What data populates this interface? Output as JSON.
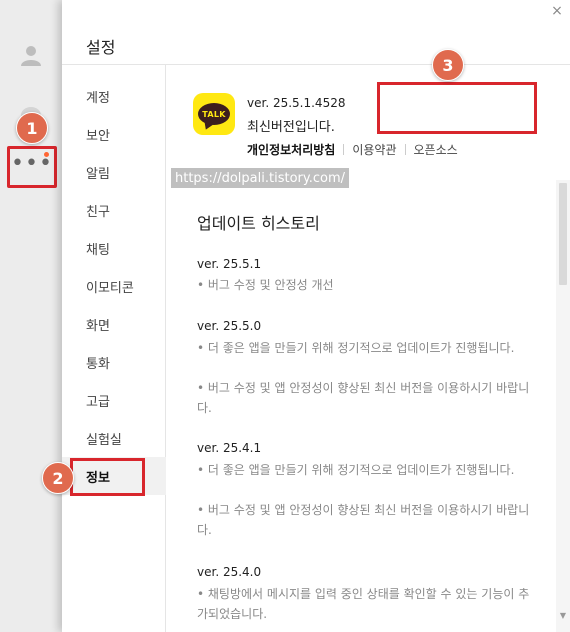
{
  "rail": {
    "icons": [
      "person-icon",
      "chat-icon",
      "more-icon"
    ],
    "more_label": "•••"
  },
  "dialog": {
    "title": "설정",
    "close_label": "×"
  },
  "nav": {
    "items": [
      {
        "label": "계정"
      },
      {
        "label": "보안"
      },
      {
        "label": "알림"
      },
      {
        "label": "친구"
      },
      {
        "label": "채팅"
      },
      {
        "label": "이모티콘"
      },
      {
        "label": "화면"
      },
      {
        "label": "통화"
      },
      {
        "label": "고급"
      },
      {
        "label": "실험실"
      },
      {
        "label": "정보",
        "active": true
      }
    ]
  },
  "info": {
    "logo_text": "TALK",
    "version": "ver. 25.5.1.4528",
    "status": "최신버전입니다.",
    "links": [
      "개인정보처리방침",
      "이용약관",
      "오픈소스"
    ]
  },
  "watermark": "https://dolpali.tistory.com/",
  "history": {
    "title": "업데이트 히스토리",
    "entries": [
      {
        "version": "ver. 25.5.1",
        "lines": [
          "• 버그 수정 및 안정성 개선"
        ]
      },
      {
        "version": "ver. 25.5.0",
        "lines": [
          "• 더 좋은 앱을 만들기 위해 정기적으로 업데이트가 진행됩니다.",
          "• 버그 수정 및 앱 안정성이 향상된 최신 버전을 이용하시기 바랍니다."
        ]
      },
      {
        "version": "ver. 25.4.1",
        "lines": [
          "• 더 좋은 앱을 만들기 위해 정기적으로 업데이트가 진행됩니다.",
          "• 버그 수정 및 앱 안정성이 향상된 최신 버전을 이용하시기 바랍니다."
        ]
      },
      {
        "version": "ver. 25.4.0",
        "lines": [
          "• 채팅방에서 메시지를 입력 중인 상태를 확인할 수 있는 기능이 추가되었습니다."
        ]
      }
    ]
  },
  "annotations": [
    "1",
    "2",
    "3"
  ],
  "colors": {
    "kakao_yellow": "#ffe812",
    "annotation_red": "#d8262c",
    "badge_orange": "#e06a4e"
  }
}
